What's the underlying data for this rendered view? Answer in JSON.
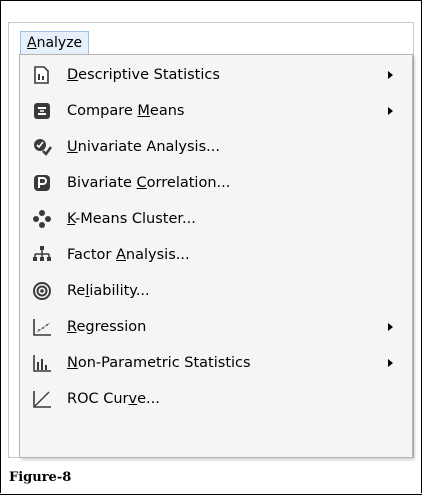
{
  "menu": {
    "title_parts": [
      "A",
      "nalyze"
    ],
    "items": [
      {
        "pre": "",
        "u": "D",
        "post": "escriptive Statistics",
        "icon": "descriptive-statistics-icon",
        "submenu": true
      },
      {
        "pre": "Compare ",
        "u": "M",
        "post": "eans",
        "icon": "compare-means-icon",
        "submenu": true
      },
      {
        "pre": "",
        "u": "U",
        "post": "nivariate Analysis...",
        "icon": "univariate-analysis-icon",
        "submenu": false
      },
      {
        "pre": "Bivariate ",
        "u": "C",
        "post": "orrelation...",
        "icon": "bivariate-correlation-icon",
        "submenu": false
      },
      {
        "pre": "",
        "u": "K",
        "post": "-Means Cluster...",
        "icon": "kmeans-cluster-icon",
        "submenu": false
      },
      {
        "pre": "Factor ",
        "u": "A",
        "post": "nalysis...",
        "icon": "factor-analysis-icon",
        "submenu": false
      },
      {
        "pre": "Re",
        "u": "l",
        "post": "iability...",
        "icon": "reliability-icon",
        "submenu": false
      },
      {
        "pre": "",
        "u": "R",
        "post": "egression",
        "icon": "regression-icon",
        "submenu": true
      },
      {
        "pre": "",
        "u": "N",
        "post": "on-Parametric Statistics",
        "icon": "non-parametric-statistics-icon",
        "submenu": true
      },
      {
        "pre": "ROC Cur",
        "u": "v",
        "post": "e...",
        "icon": "roc-curve-icon",
        "submenu": false
      }
    ]
  },
  "caption": "Figure-8",
  "colors": {
    "menu_bg": "#f5f5f5",
    "title_highlight": "#e6f0fb",
    "icon_dark": "#3a3a3a"
  }
}
